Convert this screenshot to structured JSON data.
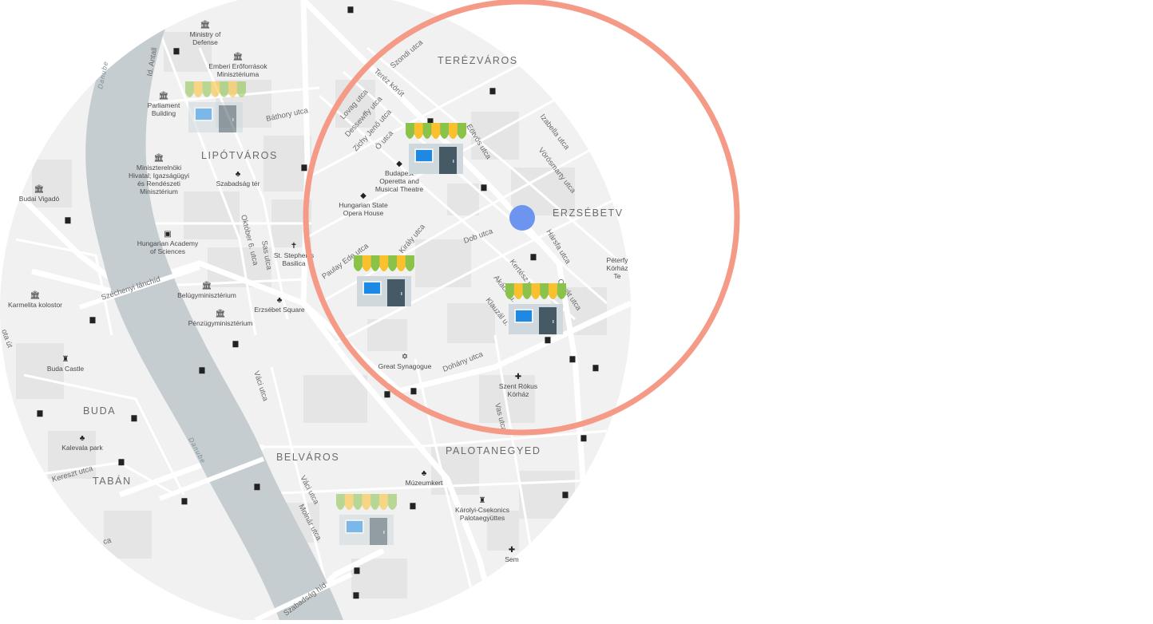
{
  "map": {
    "districts": [
      {
        "id": "terezvaros",
        "text": "TERÉZVÁROS"
      },
      {
        "id": "lipotvaros",
        "text": "LIPÓTVÁROS"
      },
      {
        "id": "erzsebetvaros",
        "text": "ERZSÉBETV"
      },
      {
        "id": "buda",
        "text": "BUDA"
      },
      {
        "id": "taban",
        "text": "TABÁN"
      },
      {
        "id": "belvaros",
        "text": "BELVÁROS"
      },
      {
        "id": "palotanegyed",
        "text": "PALOTANEGYED"
      }
    ],
    "streets": [
      {
        "id": "szondi",
        "text": "Szondi utca"
      },
      {
        "id": "terez-korut",
        "text": "Teréz körút"
      },
      {
        "id": "lovag",
        "text": "Lovag utca"
      },
      {
        "id": "dessewffy",
        "text": "Dessewffy utca"
      },
      {
        "id": "zichy",
        "text": "Zichy Jenő utca"
      },
      {
        "id": "o-utca",
        "text": "Ó utca"
      },
      {
        "id": "eotvos",
        "text": "Eötvös utca"
      },
      {
        "id": "izabella",
        "text": "Izabella utca"
      },
      {
        "id": "vorosmarty",
        "text": "Vörösmarty utca"
      },
      {
        "id": "batory",
        "text": "Báthory utca"
      },
      {
        "id": "id-antall",
        "text": "Id. Antall"
      },
      {
        "id": "oktober6",
        "text": "Október 6. utca"
      },
      {
        "id": "sas",
        "text": "Sas utca"
      },
      {
        "id": "paulay",
        "text": "Paulay Ede utca"
      },
      {
        "id": "kiraly",
        "text": "Király utca"
      },
      {
        "id": "dob",
        "text": "Dob utca"
      },
      {
        "id": "kertesz",
        "text": "Kertész u."
      },
      {
        "id": "akacfa",
        "text": "Akácfa u."
      },
      {
        "id": "klauzal",
        "text": "Klauzál u."
      },
      {
        "id": "hasfa",
        "text": "Hársfa utca"
      },
      {
        "id": "osvat",
        "text": "Osvát utca"
      },
      {
        "id": "szechenyi",
        "text": "Széchenyi lánchíd"
      },
      {
        "id": "dohany",
        "text": "Dohány utca"
      },
      {
        "id": "vaci1",
        "text": "Váci utca"
      },
      {
        "id": "vaci2",
        "text": "Váci utca"
      },
      {
        "id": "molnar",
        "text": "Molnár utca"
      },
      {
        "id": "vas",
        "text": "Vas utca"
      },
      {
        "id": "kereszt",
        "text": "Kereszt utca"
      },
      {
        "id": "szabadsag",
        "text": "Szabadság híd"
      },
      {
        "id": "ota",
        "text": "ota út"
      },
      {
        "id": "ca",
        "text": "ca"
      }
    ],
    "places": [
      {
        "id": "ministry-defense",
        "text": [
          "Ministry of",
          "Defense"
        ],
        "icon": "museum-icon"
      },
      {
        "id": "emberi",
        "text": [
          "Emberi Erőforrások",
          "Minisztériuma"
        ],
        "icon": "museum-icon"
      },
      {
        "id": "parliament",
        "text": [
          "Parliament",
          "Building"
        ],
        "icon": "museum-icon"
      },
      {
        "id": "miniszterelnoki",
        "text": [
          "Miniszterelnöki",
          "Hivatal; Igazságügyi",
          "és Rendészeti",
          "Minisztérium"
        ],
        "icon": "museum-icon"
      },
      {
        "id": "szabadsag-ter",
        "text": [
          "Szabadság tér"
        ],
        "icon": "park-icon"
      },
      {
        "id": "hungarian-academy",
        "text": [
          "Hungarian Academy",
          "of Sciences"
        ],
        "icon": "camera-icon"
      },
      {
        "id": "budai-vigado",
        "text": [
          "Budai Vigadó"
        ],
        "icon": "museum-icon"
      },
      {
        "id": "belugy",
        "text": [
          "Belügyminisztérium"
        ],
        "icon": "museum-icon"
      },
      {
        "id": "penzugy",
        "text": [
          "Pénzügyminisztérium"
        ],
        "icon": "museum-icon"
      },
      {
        "id": "st-stephen",
        "text": [
          "St. Stephen's",
          "Basilica"
        ],
        "icon": "cross-icon"
      },
      {
        "id": "erzsebet-square",
        "text": [
          "Erzsébet Square"
        ],
        "icon": "park-icon"
      },
      {
        "id": "karmelita",
        "text": [
          "Karmelita kolostor"
        ],
        "icon": "museum-icon"
      },
      {
        "id": "buda-castle",
        "text": [
          "Buda Castle"
        ],
        "icon": "castle-icon"
      },
      {
        "id": "kalevala",
        "text": [
          "Kalevala park"
        ],
        "icon": "park-icon"
      },
      {
        "id": "budapest-operetta",
        "text": [
          "Budapest",
          "Operetta and",
          "Musical Theatre"
        ],
        "icon": "theatre-icon"
      },
      {
        "id": "opera-house",
        "text": [
          "Hungarian State",
          "Opera House"
        ],
        "icon": "theatre-icon"
      },
      {
        "id": "great-synagogue",
        "text": [
          "Great Synagogue"
        ],
        "icon": "star-of-david-icon"
      },
      {
        "id": "szent-rokus",
        "text": [
          "Szent Rókus",
          "Kórház"
        ],
        "icon": "hospital-icon"
      },
      {
        "id": "peterfy",
        "text": [
          "Péterfy",
          "Kórház",
          "Te"
        ],
        "icon": "none"
      },
      {
        "id": "muzeumkert",
        "text": [
          "Múzeumkert"
        ],
        "icon": "park-icon"
      },
      {
        "id": "karolyi",
        "text": [
          "Károlyi-Csekonics",
          "Palotaegyüttes"
        ],
        "icon": "castle-icon"
      },
      {
        "id": "semmelweis",
        "text": [
          "Sem"
        ],
        "icon": "hospital-icon"
      }
    ],
    "rivers": [
      {
        "id": "danube-north",
        "text": "Danube"
      },
      {
        "id": "danube-south",
        "text": "Danube"
      }
    ],
    "shops": [
      {
        "id": "shop-1",
        "state": "faded"
      },
      {
        "id": "shop-2",
        "state": "active"
      },
      {
        "id": "shop-3",
        "state": "active"
      },
      {
        "id": "shop-4",
        "state": "active"
      },
      {
        "id": "shop-5",
        "state": "faded"
      }
    ],
    "colors": {
      "map_bg": "#f1f1f1",
      "block": "#e4e4e4",
      "road": "#ffffff",
      "river": "#c8d0d3",
      "radius_ring": "#f59a87",
      "user_location": "#6d95f0",
      "awning_green": "#8bc34a",
      "awning_yellow": "#fbc02d",
      "shop_wall": "#cfd8dc",
      "shop_window": "#1e88e5",
      "shop_door": "#455a64"
    }
  }
}
